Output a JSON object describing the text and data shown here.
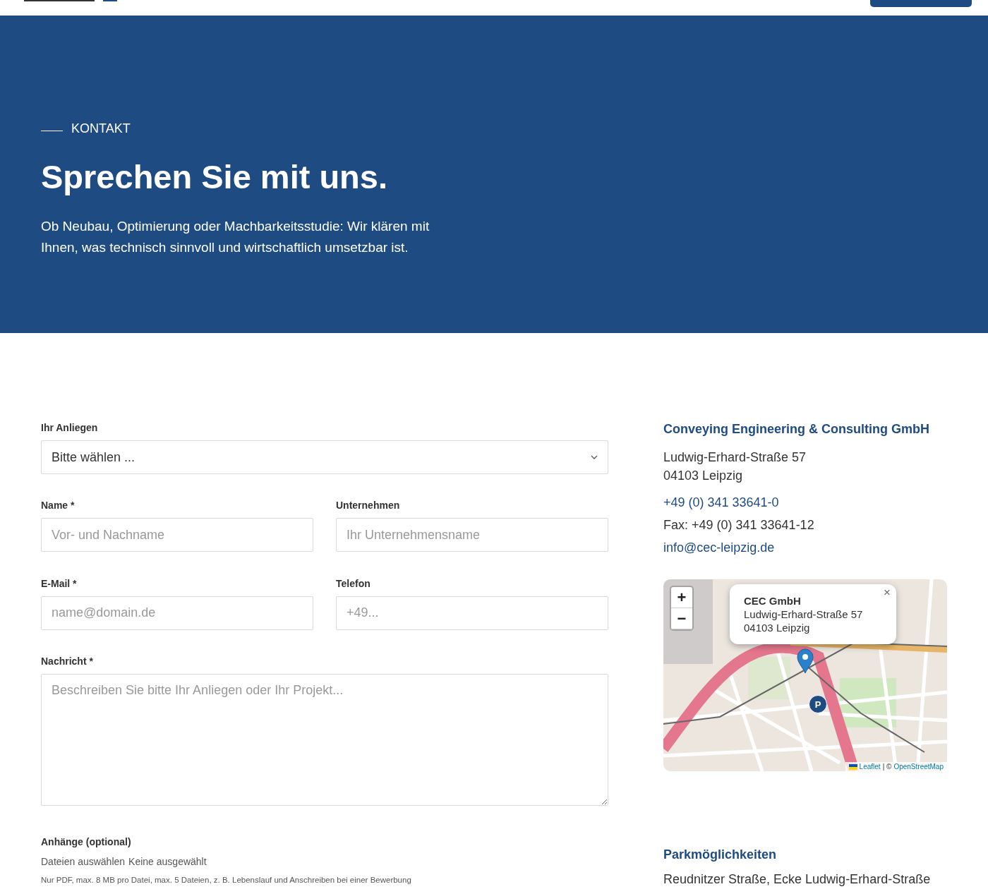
{
  "hero": {
    "eyebrow": "KONTAKT",
    "title": "Sprechen Sie mit uns.",
    "intro": "Ob Neubau, Optimierung oder Machbarkeitsstudie: Wir klären mit Ihnen, was technisch sinnvoll und wirtschaftlich umsetzbar ist."
  },
  "form": {
    "fields": [
      {
        "kind": "select",
        "label": "Ihr Anliegen",
        "value": "Bitte wählen ..."
      },
      {
        "kind": "input",
        "label": "Name *",
        "placeholder": "Vor- und Nachname"
      },
      {
        "kind": "input",
        "label": "Unternehmen",
        "placeholder": "Ihr Unternehmensname"
      },
      {
        "kind": "input",
        "label": "E-Mail *",
        "placeholder": "name@domain.de"
      },
      {
        "kind": "input",
        "label": "Telefon",
        "placeholder": "+49..."
      },
      {
        "kind": "textarea",
        "label": "Nachricht *",
        "placeholder": "Beschreiben Sie bitte Ihr Anliegen oder Ihr Projekt..."
      }
    ],
    "attachments": {
      "label": "Anhänge (optional)",
      "button": "Dateien auswählen",
      "status": "Keine ausgewählt",
      "hint": "Nur PDF, max. 8 MB pro Datei, max. 5 Dateien, z. B. Lebenslauf und Anschreiben bei einer Bewerbung"
    }
  },
  "contact": {
    "company": "Conveying Engineering & Consulting GmbH",
    "street": "Ludwig-Erhard-Straße 57",
    "city": "04103 Leipzig",
    "phone": "+49 (0) 341 33641-0",
    "fax": "Fax: +49 (0) 341 33641-12",
    "email": "info@cec-leipzig.de"
  },
  "map": {
    "zoom_in": "+",
    "zoom_out": "−",
    "popup": {
      "title": "CEC GmbH",
      "street": "Ludwig-Erhard-Straße 57",
      "city": "04103 Leipzig",
      "close": "×"
    },
    "parking_marker": "P",
    "attribution": {
      "leaflet": "Leaflet",
      "separator": "| ©",
      "osm": "OpenStreetMap"
    }
  },
  "parking": {
    "title": "Parkmöglichkeiten",
    "text": "Reudnitzer Straße, Ecke Ludwig-Erhard-Straße"
  }
}
